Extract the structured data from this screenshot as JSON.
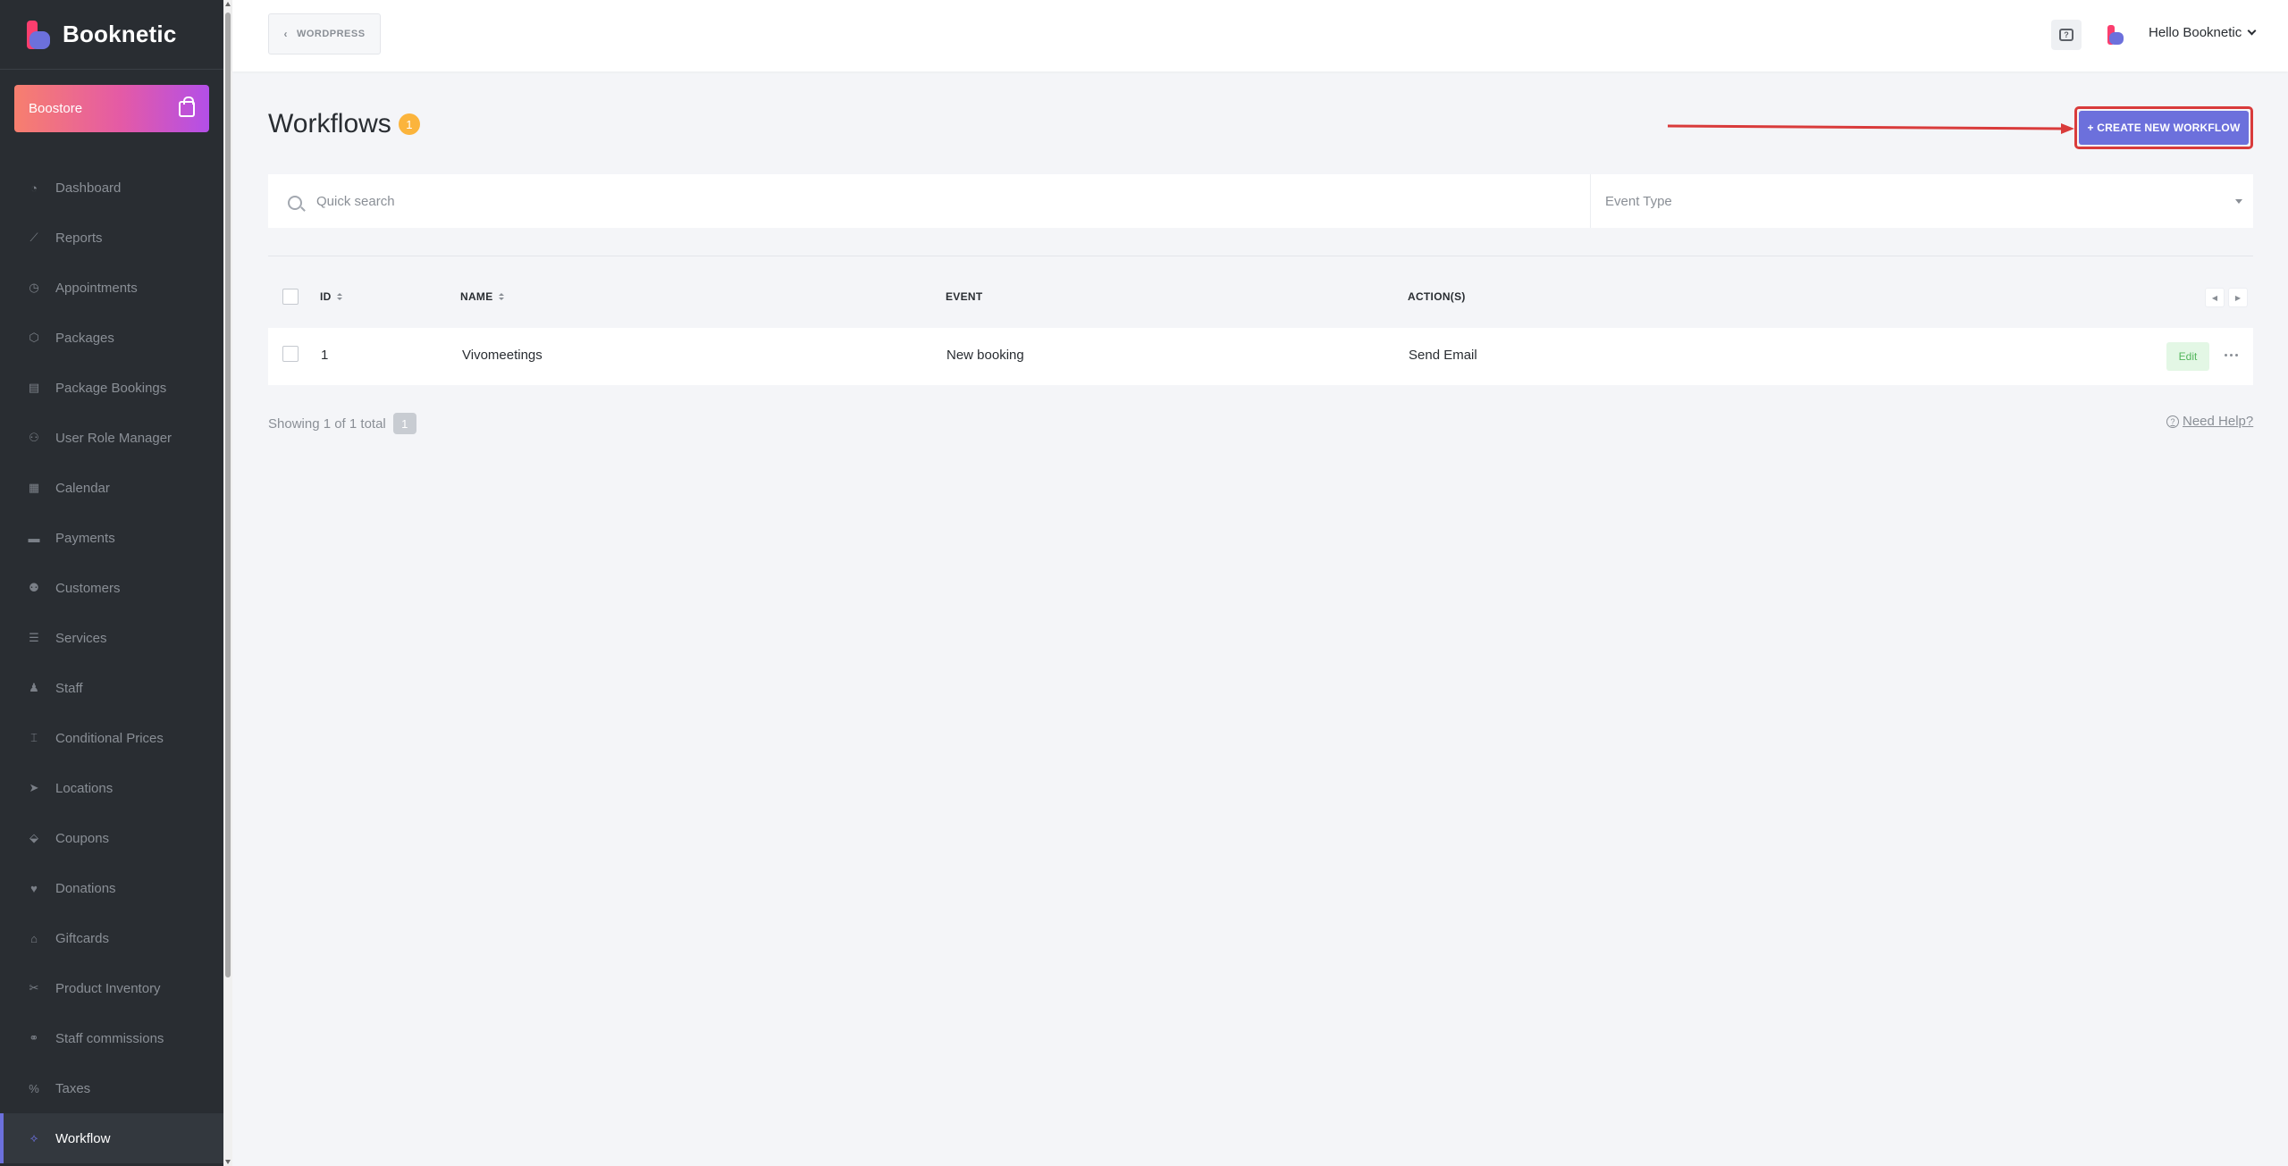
{
  "brand": {
    "name": "Booknetic"
  },
  "boostore": {
    "label": "Boostore"
  },
  "sidebar": {
    "items": [
      {
        "label": "Dashboard",
        "icon": "dashboard-icon",
        "glyph": "◔"
      },
      {
        "label": "Reports",
        "icon": "chart-line-icon",
        "glyph": "⟋"
      },
      {
        "label": "Appointments",
        "icon": "clock-icon",
        "glyph": "◷"
      },
      {
        "label": "Packages",
        "icon": "cubes-icon",
        "glyph": "⬡"
      },
      {
        "label": "Package Bookings",
        "icon": "box-icon",
        "glyph": "▤"
      },
      {
        "label": "User Role Manager",
        "icon": "user-plus-icon",
        "glyph": "⚇"
      },
      {
        "label": "Calendar",
        "icon": "calendar-icon",
        "glyph": "▦"
      },
      {
        "label": "Payments",
        "icon": "credit-card-icon",
        "glyph": "▬"
      },
      {
        "label": "Customers",
        "icon": "users-icon",
        "glyph": "⚉"
      },
      {
        "label": "Services",
        "icon": "list-icon",
        "glyph": "☰"
      },
      {
        "label": "Staff",
        "icon": "user-icon",
        "glyph": "♟"
      },
      {
        "label": "Conditional Prices",
        "icon": "i-cursor-icon",
        "glyph": "⌶"
      },
      {
        "label": "Locations",
        "icon": "location-arrow-icon",
        "glyph": "➤"
      },
      {
        "label": "Coupons",
        "icon": "tags-icon",
        "glyph": "⬙"
      },
      {
        "label": "Donations",
        "icon": "hand-holding-icon",
        "glyph": "♥"
      },
      {
        "label": "Giftcards",
        "icon": "gift-icon",
        "glyph": "⌂"
      },
      {
        "label": "Product Inventory",
        "icon": "tools-icon",
        "glyph": "✂"
      },
      {
        "label": "Staff commissions",
        "icon": "handshake-icon",
        "glyph": "⚭"
      },
      {
        "label": "Taxes",
        "icon": "percent-icon",
        "glyph": "%"
      },
      {
        "label": "Workflow",
        "icon": "workflow-icon",
        "glyph": "⟡"
      }
    ],
    "active_index": 19
  },
  "header": {
    "wordpress_label": "WORDPRESS",
    "greeting": "Hello Booknetic"
  },
  "page": {
    "title": "Workflows",
    "count": "1",
    "create_label": "+ CREATE NEW WORKFLOW"
  },
  "filters": {
    "search_placeholder": "Quick search",
    "event_type_placeholder": "Event Type"
  },
  "table": {
    "columns": {
      "id": "ID",
      "name": "NAME",
      "event": "EVENT",
      "actions": "ACTION(S)"
    },
    "rows": [
      {
        "id": "1",
        "name": "Vivomeetings",
        "event": "New booking",
        "actions": "Send Email",
        "edit_label": "Edit"
      }
    ]
  },
  "footer": {
    "showing": "Showing 1 of 1 total",
    "page": "1",
    "need_help": "Need Help?"
  },
  "colors": {
    "sidebar_bg": "#292d32",
    "accent": "#6c70dc",
    "badge": "#fbb43c",
    "annotation_red": "#d93b3b",
    "edit_green": "#53b65c"
  }
}
